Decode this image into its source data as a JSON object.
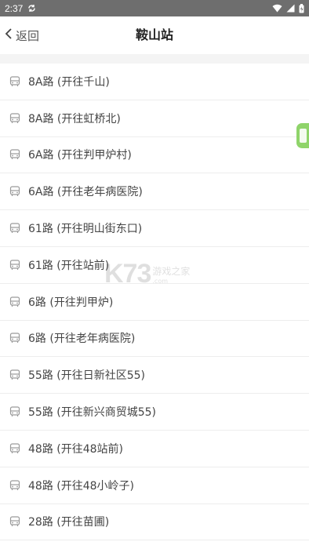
{
  "status_bar": {
    "time": "2:37",
    "icons": [
      "sync-icon",
      "wifi-icon",
      "signal-icon",
      "battery-icon"
    ]
  },
  "header": {
    "back_label": "返回",
    "title": "鞍山站"
  },
  "routes": [
    {
      "label": "8A路 (开往千山)"
    },
    {
      "label": "8A路 (开往虹桥北)"
    },
    {
      "label": "6A路 (开往判甲炉村)"
    },
    {
      "label": "6A路 (开往老年病医院)"
    },
    {
      "label": "61路 (开往明山街东口)"
    },
    {
      "label": "61路 (开往站前)"
    },
    {
      "label": "6路 (开往判甲炉)"
    },
    {
      "label": "6路 (开往老年病医院)"
    },
    {
      "label": "55路 (开往日新社区55)"
    },
    {
      "label": "55路 (开往新兴商贸城55)"
    },
    {
      "label": "48路 (开往48站前)"
    },
    {
      "label": "48路 (开往48小岭子)"
    },
    {
      "label": "28路 (开往苗圃)"
    }
  ],
  "watermark": {
    "big": "K73",
    "small": "游戏之家",
    "tiny": ".com"
  },
  "colors": {
    "status_bar": "#6e6e6e",
    "side_tab": "#8fd46a",
    "divider": "#f4f4f4"
  }
}
